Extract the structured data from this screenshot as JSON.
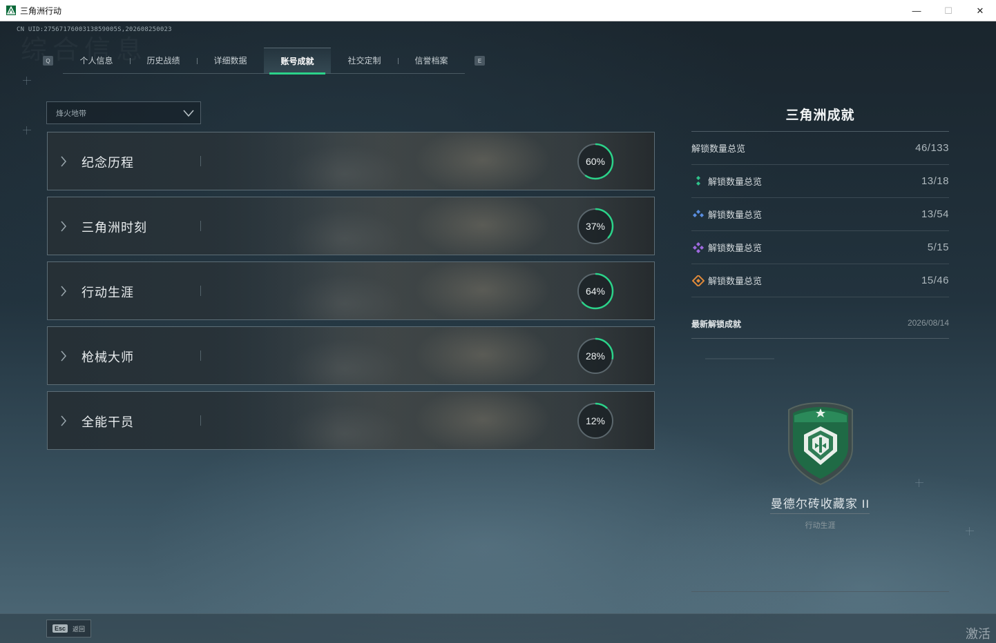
{
  "window": {
    "title": "三角洲行动",
    "minimize": "—",
    "maximize": "☐",
    "close": "✕"
  },
  "uid": "CN UID:2756717600313859005S,202608250023",
  "watermark": "综合信息",
  "tabs": {
    "left_key": "Q",
    "right_key": "E",
    "items": [
      {
        "label": "个人信息",
        "active": false
      },
      {
        "label": "历史战绩",
        "active": false
      },
      {
        "label": "详细数据",
        "active": false
      },
      {
        "label": "账号成就",
        "active": true
      },
      {
        "label": "社交定制",
        "active": false
      },
      {
        "label": "信誉档案",
        "active": false
      }
    ]
  },
  "dropdown": {
    "value": "烽火地带",
    "icon": "chevron-down-icon"
  },
  "categories": [
    {
      "name": "纪念历程",
      "percent_label": "60%",
      "progress": 0.6
    },
    {
      "name": "三角洲时刻",
      "percent_label": "37%",
      "progress": 0.37
    },
    {
      "name": "行动生涯",
      "percent_label": "64%",
      "progress": 0.64
    },
    {
      "name": "枪械大师",
      "percent_label": "28%",
      "progress": 0.28
    },
    {
      "name": "全能干员",
      "percent_label": "12%",
      "progress": 0.12
    }
  ],
  "panel": {
    "title": "三角洲成就",
    "stats": [
      {
        "label": "解锁数量总览",
        "value": "46/133",
        "icon": "none"
      },
      {
        "label": "解锁数量总览",
        "value": "13/18",
        "icon": "green-rank-icon"
      },
      {
        "label": "解锁数量总览",
        "value": "13/54",
        "icon": "blue-rank-icon"
      },
      {
        "label": "解锁数量总览",
        "value": "5/15",
        "icon": "purple-rank-icon"
      },
      {
        "label": "解锁数量总览",
        "value": "15/46",
        "icon": "gold-rank-icon"
      }
    ],
    "latest_label": "最新解锁成就",
    "latest_date": "2026/08/14",
    "latest_badge_name": "曼德尔砖收藏家 II",
    "latest_badge_category": "行动生涯"
  },
  "bottom": {
    "esc_key": "Esc",
    "esc_label": "返回",
    "activate_text": "激活"
  },
  "colors": {
    "accent_green": "#2bd38a",
    "rank_green": "#2fc28a",
    "rank_blue": "#5a8ee0",
    "rank_purple": "#a06ae0",
    "rank_gold": "#e08a3a"
  }
}
